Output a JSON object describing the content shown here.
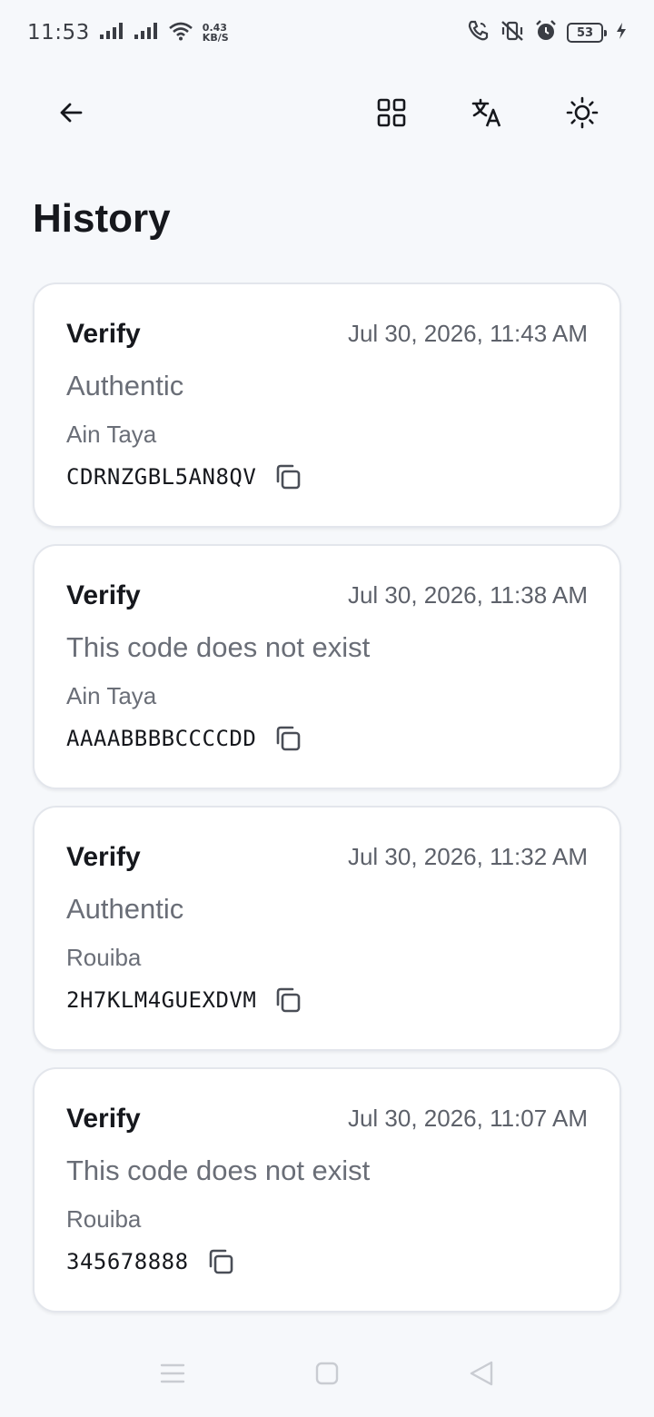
{
  "status_bar": {
    "time": "11:53",
    "net_speed_value": "0.43",
    "net_speed_unit": "KB/S",
    "battery_level": "53",
    "icons": [
      "signal-icon",
      "signal-icon",
      "wifi-icon",
      "wifi-call-icon",
      "vibrate-off-icon",
      "alarm-icon",
      "battery-icon",
      "charging-icon"
    ]
  },
  "top_bar": {
    "icons": [
      "back-arrow-icon",
      "grid-icon",
      "translate-icon",
      "brightness-icon"
    ]
  },
  "page": {
    "title": "History"
  },
  "history": [
    {
      "type": "Verify",
      "date": "Jul 30, 2026, 11:43 AM",
      "result": "Authentic",
      "location": "Ain Taya",
      "code": "CDRNZGBL5AN8QV"
    },
    {
      "type": "Verify",
      "date": "Jul 30, 2026, 11:38 AM",
      "result": "This code does not exist",
      "location": "Ain Taya",
      "code": "AAAABBBBCCCCDD"
    },
    {
      "type": "Verify",
      "date": "Jul 30, 2026, 11:32 AM",
      "result": "Authentic",
      "location": "Rouiba",
      "code": "2H7KLM4GUEXDVM"
    },
    {
      "type": "Verify",
      "date": "Jul 30, 2026, 11:07 AM",
      "result": "This code does not exist",
      "location": "Rouiba",
      "code": "345678888"
    }
  ],
  "nav_bar": {
    "icons": [
      "menu-icon",
      "home-square-icon",
      "back-triangle-icon"
    ]
  },
  "colors": {
    "background": "#f6f8fb",
    "card": "#ffffff",
    "text_primary": "#16181d",
    "text_secondary": "#6a6e77"
  }
}
